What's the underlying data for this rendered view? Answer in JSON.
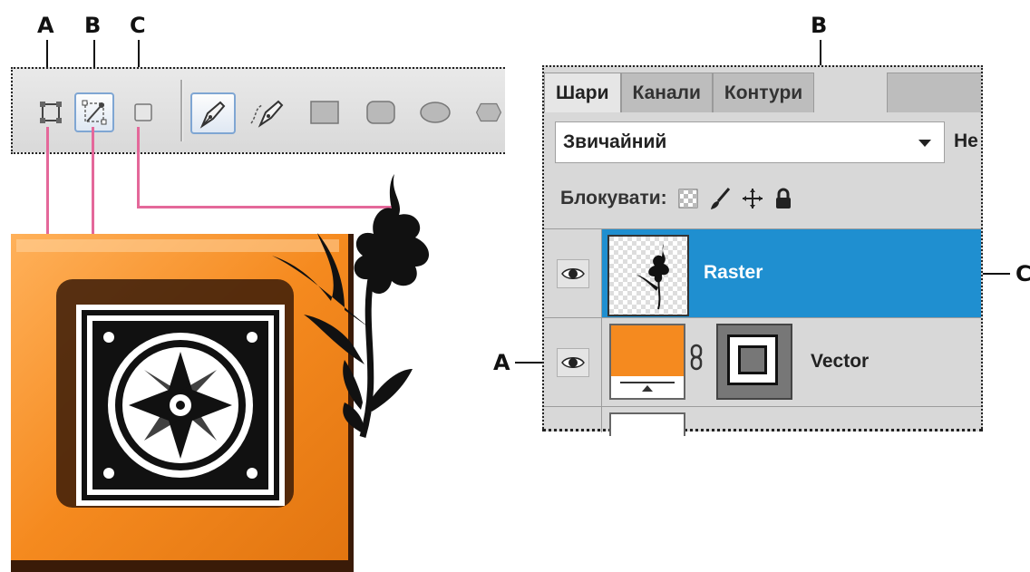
{
  "callouts": {
    "left": [
      "A",
      "B",
      "C"
    ],
    "panel_top": "B",
    "panel_right": "C",
    "panel_left": "A"
  },
  "toolbar": {
    "tools": [
      "shape-layers-icon",
      "paths-icon",
      "fill-pixels-icon",
      "pen-icon",
      "freeform-pen-icon",
      "rectangle-icon",
      "rounded-rectangle-icon",
      "ellipse-icon",
      "polygon-icon"
    ],
    "selected_tool": "pen-icon"
  },
  "layers_panel": {
    "tabs": [
      "Шари",
      "Канали",
      "Контури"
    ],
    "active_tab": "Шари",
    "blend_mode": "Звичайний",
    "opacity_label_partial": "Не",
    "lock_label": "Блокувати:",
    "lock_icons": [
      "lock-transparent-icon",
      "lock-image-icon",
      "lock-position-icon",
      "lock-all-icon"
    ],
    "layers": [
      {
        "name": "Raster",
        "selected": true
      },
      {
        "name": "Vector",
        "selected": false
      }
    ]
  },
  "colors": {
    "selection_blue": "#1f8fd0",
    "callout_line": "#e4689a",
    "orange": "#f58a1f"
  }
}
